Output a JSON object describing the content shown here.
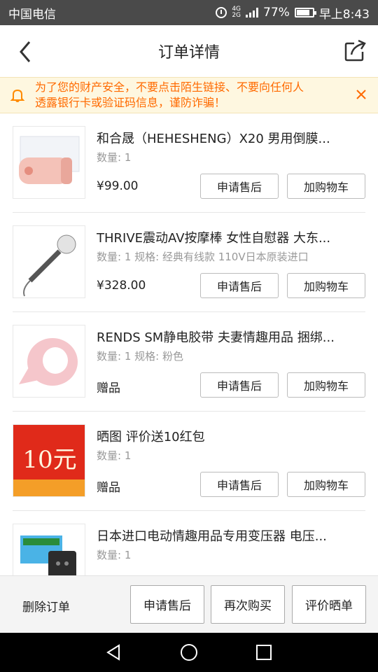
{
  "status_bar": {
    "carrier": "中国电信",
    "network_top": "4G",
    "network_bottom": "2G",
    "battery": "77%",
    "time": "早上8:43"
  },
  "header": {
    "title": "订单详情",
    "back_icon": "back-arrow-icon",
    "share_icon": "share-icon"
  },
  "warning": {
    "line1": "为了您的财产安全，不要点击陌生链接、不要向任何人",
    "line2": "透露银行卡或验证码信息，谨防诈骗！",
    "color": "#ff6a00"
  },
  "items": [
    {
      "title": "和合晟（HEHESHENG）X20 男用倒膜...",
      "meta": "数量: 1",
      "price": "¥99.00",
      "aftersale": "申请售后",
      "addcart": "加购物车"
    },
    {
      "title": "THRIVE震动AV按摩棒 女性自慰器 大东...",
      "meta": "数量: 1 规格: 经典有线款 110V日本原装进口",
      "price": "¥328.00",
      "aftersale": "申请售后",
      "addcart": "加购物车"
    },
    {
      "title": "RENDS SM静电胶带 夫妻情趣用品 捆绑...",
      "meta": "数量: 1 规格: 粉色",
      "price": "赠品",
      "aftersale": "申请售后",
      "addcart": "加购物车"
    },
    {
      "title": "晒图 评价送10红包",
      "meta": "数量: 1",
      "price": "赠品",
      "aftersale": "申请售后",
      "addcart": "加购物车",
      "thumb_text": "10元"
    },
    {
      "title": "日本进口电动情趣用品专用变压器 电压...",
      "meta": "数量: 1"
    }
  ],
  "bottom_bar": {
    "delete": "删除订单",
    "aftersale": "申请售后",
    "rebuy": "再次购买",
    "review": "评价晒单"
  },
  "system_nav": [
    "back-triangle-icon",
    "home-circle-icon",
    "recents-square-icon"
  ]
}
